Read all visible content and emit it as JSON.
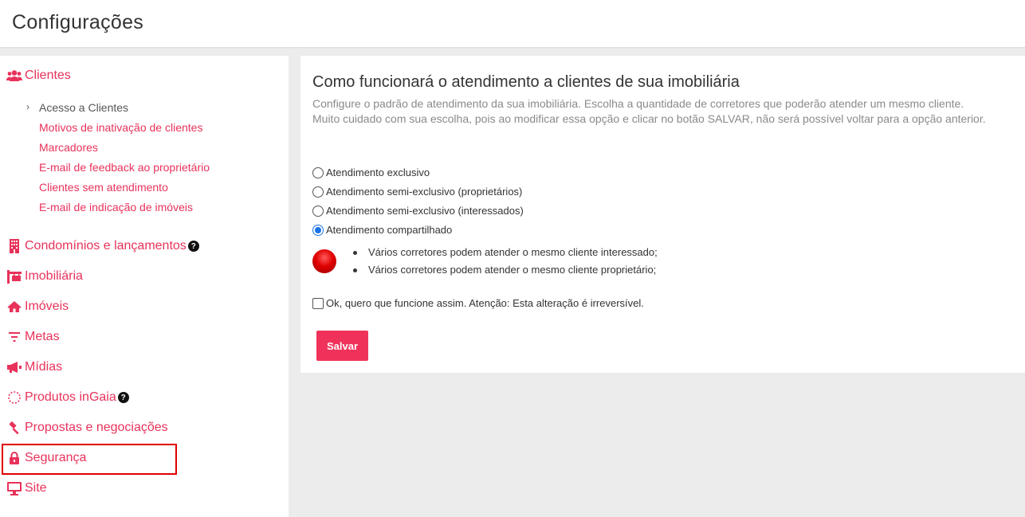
{
  "header": {
    "title": "Configurações"
  },
  "sidebar": {
    "clientes": {
      "label": "Clientes",
      "subitems": [
        {
          "label": "Acesso a Clientes"
        },
        {
          "label": "Motivos de inativação de clientes"
        },
        {
          "label": "Marcadores"
        },
        {
          "label": "E-mail de feedback ao proprietário"
        },
        {
          "label": "Clientes sem atendimento"
        },
        {
          "label": "E-mail de indicação de imóveis"
        }
      ]
    },
    "items": [
      {
        "label": "Condomínios e lançamentos",
        "icon": "building-icon",
        "help": "?"
      },
      {
        "label": "Imobiliária",
        "icon": "office-sign-icon"
      },
      {
        "label": "Imóveis",
        "icon": "home-icon"
      },
      {
        "label": "Metas",
        "icon": "filter-icon"
      },
      {
        "label": "Mídias",
        "icon": "megaphone-icon"
      },
      {
        "label": "Produtos inGaia",
        "icon": "ingaia-icon",
        "help": "?"
      },
      {
        "label": "Propostas e negociações",
        "icon": "gavel-icon"
      },
      {
        "label": "Segurança",
        "icon": "lock-icon"
      },
      {
        "label": "Site",
        "icon": "monitor-icon"
      }
    ]
  },
  "panel": {
    "title": "Como funcionará o atendimento a clientes de sua imobiliária",
    "description_line1": "Configure o padrão de atendimento da sua imobiliária. Escolha a quantidade de corretores que poderão atender um mesmo cliente.",
    "description_line2": "Muito cuidado com sua escolha, pois ao modificar essa opção e clicar no botão SALVAR, não será possível voltar para a opção anterior.",
    "options": [
      {
        "label": "Atendimento exclusivo",
        "selected": false
      },
      {
        "label": "Atendimento semi-exclusivo (proprietários)",
        "selected": false
      },
      {
        "label": "Atendimento semi-exclusivo (interessados)",
        "selected": false
      },
      {
        "label": "Atendimento compartilhado",
        "selected": true
      }
    ],
    "bullets": [
      "Vários corretores podem atender o mesmo cliente interessado;",
      "Vários corretores podem atender o mesmo cliente proprietário;"
    ],
    "confirm_label": "Ok, quero que funcione assim. Atenção: Esta alteração é irreversível.",
    "confirm_checked": false,
    "save_label": "Salvar"
  },
  "colors": {
    "accent": "#e8325a",
    "button": "#f0325a",
    "highlight_border": "#e00000",
    "radio_selected": "#1a73e8"
  }
}
